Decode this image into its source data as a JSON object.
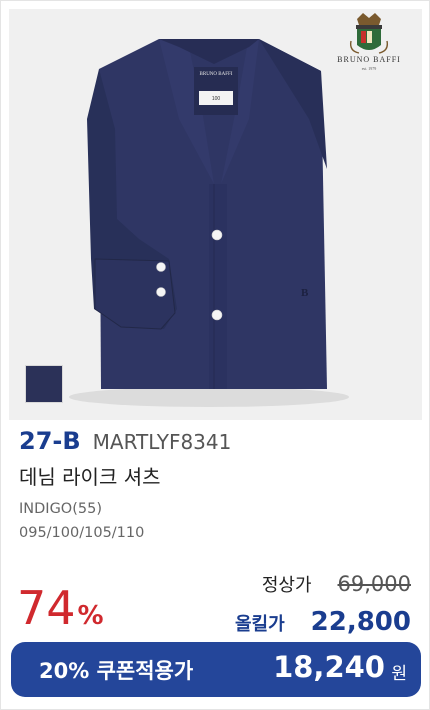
{
  "brand": {
    "name": "BRUNO BAFFI",
    "since": "est. 1979",
    "label_brand": "BRUNO BAFFI",
    "label_size": "100"
  },
  "product": {
    "code": "27-B",
    "model": "MARTLYF8341",
    "name": "데님 라이크 셔츠",
    "color": "INDIGO(55)",
    "sizes": "095/100/105/110",
    "swatch_color": "#2b3158",
    "shirt_color": "#2f3664"
  },
  "pricing": {
    "discount_value": "74",
    "discount_unit": "%",
    "regular_label": "정상가",
    "regular_price": "69,000",
    "sale_label": "올킬가",
    "sale_price": "22,800"
  },
  "coupon": {
    "label": "20% 쿠폰적용가",
    "price": "18,240",
    "unit": "원",
    "bg_color": "#24469a"
  },
  "colors": {
    "accent_blue": "#1a3d8f",
    "discount_red": "#d0292e"
  }
}
